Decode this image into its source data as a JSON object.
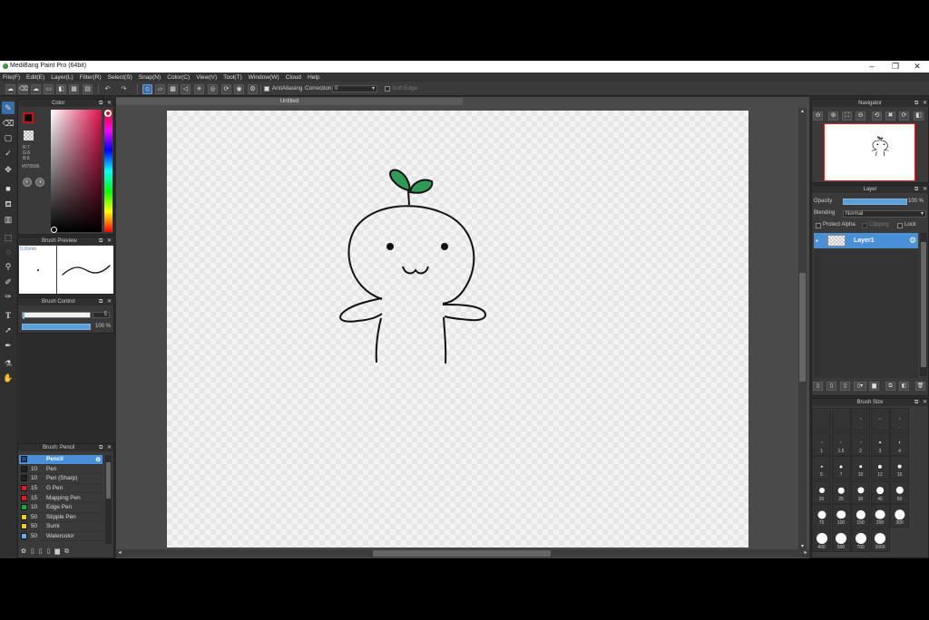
{
  "window": {
    "title": "MediBang Paint Pro (64bit)",
    "controls": [
      "–",
      "❐",
      "✕"
    ]
  },
  "menu": [
    "File(F)",
    "Edit(E)",
    "Layer(L)",
    "Filter(R)",
    "Select(S)",
    "Snap(N)",
    "Color(C)",
    "View(V)",
    "Tool(T)",
    "Window(W)",
    "Cloud",
    "Help"
  ],
  "toolbar": {
    "antialiasing_label": "AntiAliasing",
    "correction_label": "Correction",
    "correction_value": "0",
    "soft_edge_label": "Soft Edge"
  },
  "color_panel": {
    "title": "Color",
    "r": "R:7",
    "g": "G:6",
    "b": "B:6",
    "hex": "#070606",
    "primary": "#cc1111",
    "secondary": "#ffffff"
  },
  "brush_preview": {
    "title": "Brush Preview",
    "size_label": "0.36mm"
  },
  "brush_control": {
    "title": "Brush Control",
    "size_value": "5",
    "opacity_value": "100 %",
    "size_fraction": 0.02,
    "opacity_fraction": 1.0
  },
  "brush_list": {
    "title": "Brush: Pencil",
    "items": [
      {
        "size": "",
        "name": "Pencil",
        "color": "#2a4a6a",
        "selected": true
      },
      {
        "size": "10",
        "name": "Pen",
        "color": "#222222",
        "selected": false
      },
      {
        "size": "10",
        "name": "Pen (Sharp)",
        "color": "#222222",
        "selected": false
      },
      {
        "size": "15",
        "name": "G Pen",
        "color": "#d42020",
        "selected": false
      },
      {
        "size": "15",
        "name": "Mapping Pen",
        "color": "#d42020",
        "selected": false
      },
      {
        "size": "10",
        "name": "Edge Pen",
        "color": "#1aa83a",
        "selected": false
      },
      {
        "size": "50",
        "name": "Stipple Pen",
        "color": "#e8d020",
        "selected": false
      },
      {
        "size": "50",
        "name": "Sumi",
        "color": "#e8d020",
        "selected": false
      },
      {
        "size": "50",
        "name": "Watercolor",
        "color": "#6ab0e8",
        "selected": false
      }
    ]
  },
  "document": {
    "tab_title": "Untitled"
  },
  "navigator": {
    "title": "Navigator"
  },
  "layer_panel": {
    "title": "Layer",
    "opacity_label": "Opacity",
    "opacity_value": "100 %",
    "opacity_fraction": 1.0,
    "blending_label": "Blending",
    "blending_value": "Normal",
    "protect_alpha_label": "Protect Alpha",
    "clipping_label": "Clipping",
    "lock_label": "Lock",
    "layers": [
      {
        "name": "Layer1"
      }
    ]
  },
  "brush_size_panel": {
    "title": "Brush Size",
    "sizes": [
      "",
      "",
      ".",
      ".",
      ".",
      "1",
      "1.5",
      "2",
      "3",
      "4",
      "5",
      "7",
      "10",
      "12",
      "15",
      "20",
      "25",
      "30",
      "40",
      "50",
      "70",
      "100",
      "150",
      "200",
      "300",
      "400",
      "500",
      "700",
      "1000"
    ]
  },
  "icons": {
    "tools": [
      "pencil-tool-icon",
      "eraser-icon",
      "rect-tool-icon",
      "check-icon",
      "move-icon",
      "fill-rect-icon",
      "bucket-icon",
      "gradient-icon",
      "select-rect-icon",
      "lasso-icon",
      "magic-wand-icon",
      "select-pen-icon",
      "select-eraser-icon",
      "text-icon",
      "operation-icon",
      "dropper-icon",
      "eyedropper-icon",
      "hand-icon"
    ]
  }
}
